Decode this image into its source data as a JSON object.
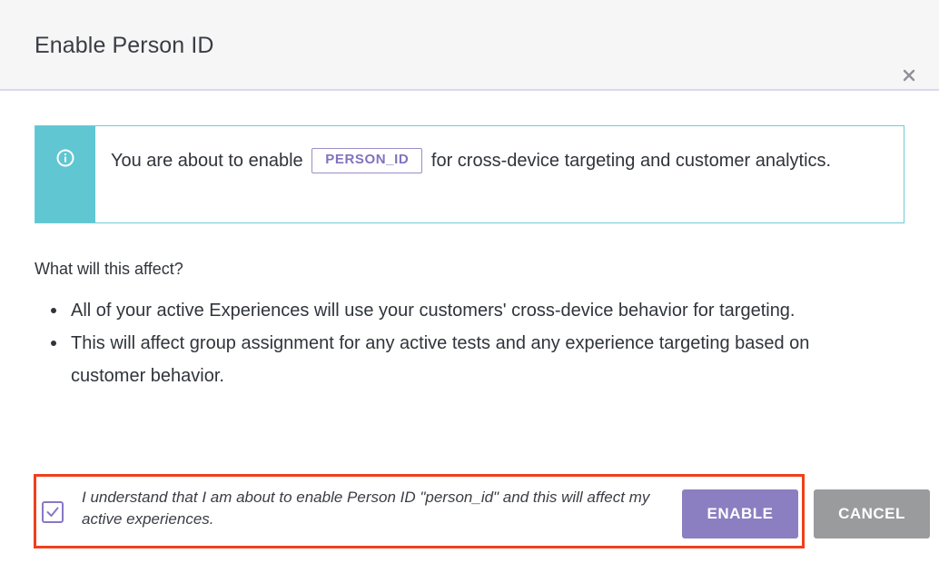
{
  "dialog": {
    "title": "Enable Person ID",
    "close_symbol": "×"
  },
  "callout": {
    "icon": "info-circle-icon",
    "text_before": "You are about to enable",
    "code": "PERSON_ID",
    "text_after": "for cross-device targeting and customer analytics.",
    "accent_color": "#5fc6d2"
  },
  "affect": {
    "heading": "What will this affect?",
    "items": [
      "All of your active Experiences will use your customers' cross-device behavior for targeting.",
      "This will affect group assignment for any active tests and any experience targeting based on customer behavior."
    ]
  },
  "confirm": {
    "checked": true,
    "text": "I understand that I am about to enable Person ID \"person_id\" and this will affect my active experiences.",
    "highlight_color": "#f0401b"
  },
  "buttons": {
    "enable_label": "ENABLE",
    "cancel_label": "CANCEL",
    "enable_color": "#8b7fc1",
    "cancel_color": "#9a9b9d"
  }
}
